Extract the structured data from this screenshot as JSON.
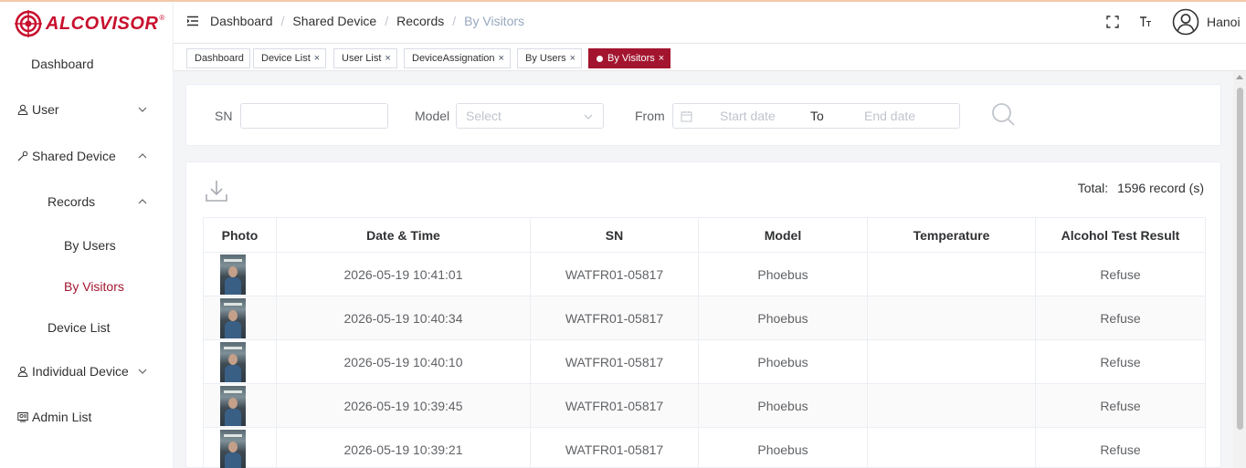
{
  "app": {
    "brand": "ALCOVISOR",
    "brand_mark": "®",
    "brand_color": "#c8102e",
    "accent": "#a3152f"
  },
  "sidebar": {
    "items": [
      {
        "label": "Dashboard",
        "icon": ""
      },
      {
        "label": "User",
        "icon": "user-icon"
      },
      {
        "label": "Shared Device",
        "icon": "share-icon"
      },
      {
        "label": "Records",
        "icon": ""
      },
      {
        "label": "By Users",
        "icon": ""
      },
      {
        "label": "By Visitors",
        "icon": ""
      },
      {
        "label": "Device List",
        "icon": ""
      },
      {
        "label": "Individual Device",
        "icon": "user-icon"
      },
      {
        "label": "Admin List",
        "icon": "admin-icon"
      }
    ]
  },
  "header": {
    "breadcrumb": [
      "Dashboard",
      "Shared Device",
      "Records",
      "By Visitors"
    ],
    "username": "Hanoi"
  },
  "tags": [
    {
      "label": "Dashboard",
      "closable": false,
      "active": false
    },
    {
      "label": "Device List",
      "closable": true,
      "active": false
    },
    {
      "label": "User List",
      "closable": true,
      "active": false
    },
    {
      "label": "DeviceAssignation",
      "closable": true,
      "active": false
    },
    {
      "label": "By Users",
      "closable": true,
      "active": false
    },
    {
      "label": "By Visitors",
      "closable": true,
      "active": true
    }
  ],
  "tag_close": "×",
  "filters": {
    "sn_label": "SN",
    "sn_value": "",
    "model_label": "Model",
    "model_placeholder": "Select",
    "from_label": "From",
    "start_placeholder": "Start date",
    "to_label": "To",
    "end_placeholder": "End date"
  },
  "table": {
    "total_label": "Total:",
    "total_value": "1596 record (s)",
    "columns": [
      "Photo",
      "Date & Time",
      "SN",
      "Model",
      "Temperature",
      "Alcohol Test Result"
    ],
    "rows": [
      {
        "datetime": "2026-05-19 10:41:01",
        "sn": "WATFR01-05817",
        "model": "Phoebus",
        "temperature": "",
        "result": "Refuse"
      },
      {
        "datetime": "2026-05-19 10:40:34",
        "sn": "WATFR01-05817",
        "model": "Phoebus",
        "temperature": "",
        "result": "Refuse"
      },
      {
        "datetime": "2026-05-19 10:40:10",
        "sn": "WATFR01-05817",
        "model": "Phoebus",
        "temperature": "",
        "result": "Refuse"
      },
      {
        "datetime": "2026-05-19 10:39:45",
        "sn": "WATFR01-05817",
        "model": "Phoebus",
        "temperature": "",
        "result": "Refuse"
      },
      {
        "datetime": "2026-05-19 10:39:21",
        "sn": "WATFR01-05817",
        "model": "Phoebus",
        "temperature": "",
        "result": "Refuse"
      }
    ]
  }
}
